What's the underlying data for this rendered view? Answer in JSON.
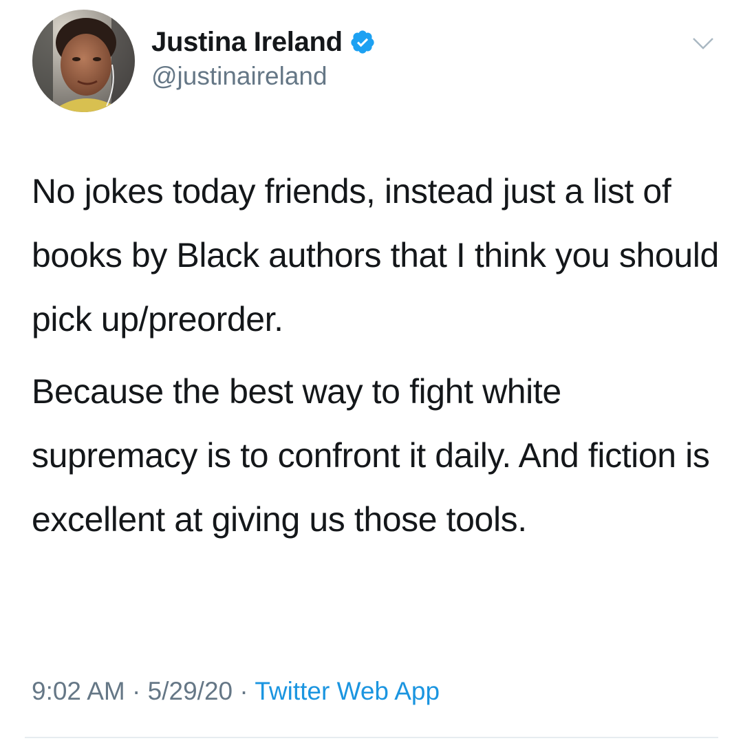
{
  "author": {
    "display_name": "Justina Ireland",
    "handle": "@justinaireland",
    "verified": true,
    "verified_badge_color": "#1da1f2",
    "avatar_icon": "profile-photo"
  },
  "menu_icon": "chevron-down-icon",
  "tweet": {
    "paragraph_1": "No jokes today friends, instead just a list of books by Black authors that I think you should pick up/preorder.",
    "paragraph_2": "Because the best way to fight white supremacy is to confront it daily. And fiction is excellent at giving us those tools."
  },
  "meta": {
    "time": "9:02 AM",
    "separator": "·",
    "date": "5/29/20",
    "source": "Twitter Web App"
  },
  "colors": {
    "text": "#14171a",
    "secondary": "#657786",
    "link": "#1b95e0",
    "divider": "#e6ecf0"
  }
}
